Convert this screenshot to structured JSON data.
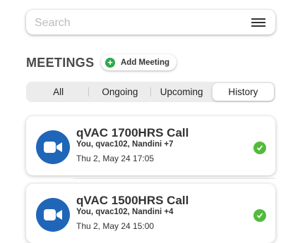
{
  "search": {
    "placeholder": "Search",
    "value": ""
  },
  "section": {
    "title": "MEETINGS",
    "add_label": "Add Meeting"
  },
  "tabs": [
    {
      "label": "All",
      "active": false
    },
    {
      "label": "Ongoing",
      "active": false
    },
    {
      "label": "Upcoming",
      "active": false
    },
    {
      "label": "History",
      "active": true
    }
  ],
  "meetings": [
    {
      "title": "qVAC 1700HRS Call",
      "participants": "You, qvac102, Nandini +7",
      "time": "Thu 2, May 24 17:05",
      "status": "completed"
    },
    {
      "title": "qVAC 1500HRS Call",
      "participants": "You, qvac102, Nandini +4",
      "time": "Thu 2, May 24 15:00",
      "status": "completed"
    }
  ],
  "colors": {
    "avatar": "#1f66b8",
    "status": "#52bb3b",
    "add_icon": "#2ea84a"
  }
}
